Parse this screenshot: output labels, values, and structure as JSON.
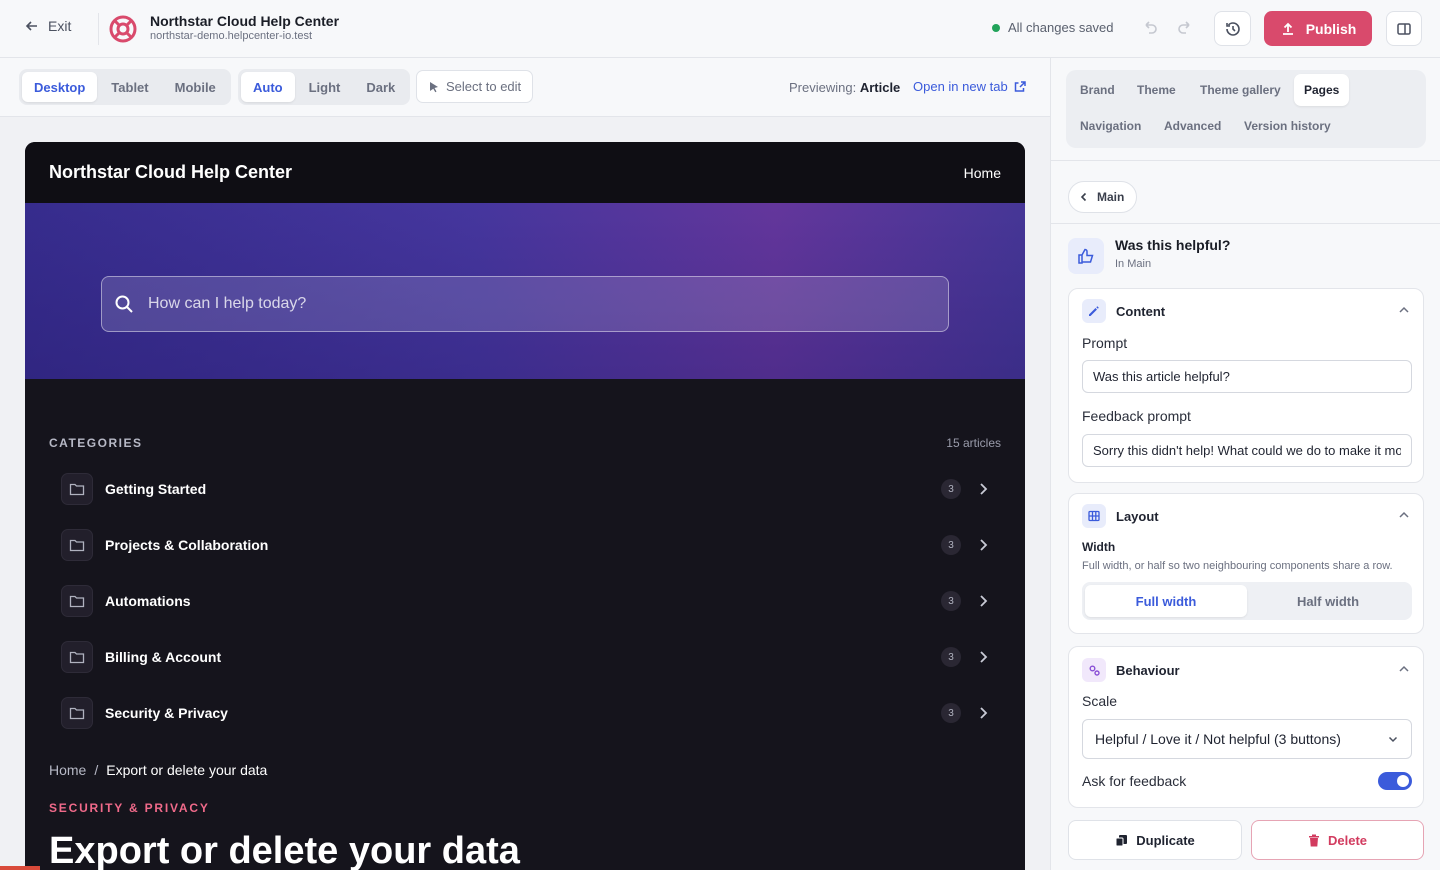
{
  "topbar": {
    "exit_label": "Exit",
    "site_title": "Northstar Cloud Help Center",
    "site_domain": "northstar-demo.helpcenter-io.test",
    "save_status": "All changes saved",
    "publish_label": "Publish"
  },
  "toolbar": {
    "devices": [
      "Desktop",
      "Tablet",
      "Mobile"
    ],
    "active_device": "Desktop",
    "modes": [
      "Auto",
      "Light",
      "Dark"
    ],
    "active_mode": "Auto",
    "select_to_edit": "Select to edit",
    "previewing_label": "Previewing:",
    "previewing_value": "Article",
    "open_new_tab": "Open in new tab"
  },
  "preview": {
    "site_name": "Northstar Cloud Help Center",
    "nav_home": "Home",
    "search_placeholder": "How can I help today?",
    "categories_label": "CATEGORIES",
    "articles_count": "15 articles",
    "categories": [
      {
        "name": "Getting Started",
        "count": "3"
      },
      {
        "name": "Projects & Collaboration",
        "count": "3"
      },
      {
        "name": "Automations",
        "count": "3"
      },
      {
        "name": "Billing & Account",
        "count": "3"
      },
      {
        "name": "Security & Privacy",
        "count": "3"
      }
    ],
    "breadcrumb": {
      "home": "Home",
      "sep": "/",
      "current": "Export or delete your data"
    },
    "article_category": "SECURITY & PRIVACY",
    "article_title": "Export or delete your data"
  },
  "panel": {
    "tabs_row1": [
      "Brand",
      "Theme",
      "Theme gallery",
      "Pages"
    ],
    "tabs_row2": [
      "Navigation",
      "Advanced",
      "Version history"
    ],
    "active_tab": "Pages",
    "back_label": "Main",
    "component_title": "Was this helpful?",
    "component_sub": "In Main",
    "content": {
      "title": "Content",
      "prompt_label": "Prompt",
      "prompt_value": "Was this article helpful?",
      "feedback_label": "Feedback prompt",
      "feedback_value": "Sorry this didn't help! What could we do to make it mo"
    },
    "layout": {
      "title": "Layout",
      "width_label": "Width",
      "width_help": "Full width, or half so two neighbouring components share a row.",
      "options": [
        "Full width",
        "Half width"
      ],
      "active": "Full width"
    },
    "behaviour": {
      "title": "Behaviour",
      "scale_label": "Scale",
      "scale_value": "Helpful / Love it / Not helpful (3 buttons)",
      "ask_feedback_label": "Ask for feedback",
      "ask_feedback_on": true
    },
    "duplicate_label": "Duplicate",
    "delete_label": "Delete"
  },
  "colors": {
    "accent": "#3b5bdb",
    "publish": "#d94a6c",
    "danger": "#d23b5f",
    "success": "#22a35a",
    "preview_bg": "#15141c"
  }
}
